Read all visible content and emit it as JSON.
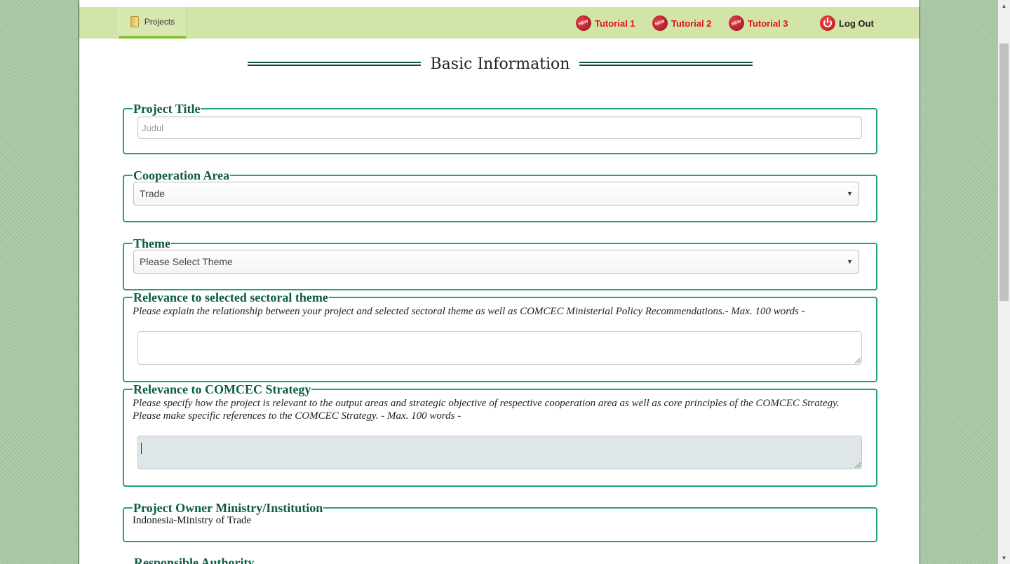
{
  "nav": {
    "projects_label": "Projects",
    "tutorials": [
      "Tutorial 1",
      "Tutorial 2",
      "Tutorial 3"
    ],
    "logout_label": "Log Out",
    "new_badge": "NEW"
  },
  "heading": "Basic Information",
  "sections": {
    "project_title": {
      "legend": "Project Title",
      "placeholder": "Judul"
    },
    "cooperation_area": {
      "legend": "Cooperation Area",
      "selected": "Trade"
    },
    "theme": {
      "legend": "Theme",
      "selected": "Please Select Theme"
    },
    "relevance_theme": {
      "legend": "Relevance to selected sectoral theme",
      "hint": "Please explain the relationship between your project and selected sectoral theme as well as COMCEC Ministerial Policy Recommendations.- Max. 100 words -"
    },
    "relevance_strategy": {
      "legend": "Relevance to COMCEC Strategy",
      "hint": "Please specify how the project is relevant to the output areas and strategic objective of respective cooperation area as well as core principles of the COMCEC Strategy. Please make specific references to the COMCEC Strategy. - Max. 100 words -"
    },
    "owner": {
      "legend": "Project Owner Ministry/Institution",
      "value": "Indonesia-Ministry of Trade"
    },
    "responsible_authority": {
      "legend": "Responsible Authority"
    }
  },
  "colors": {
    "accent": "#1fa37d",
    "legend": "#0d5c46",
    "navbar": "#d3e4a9",
    "tutorial": "#e01414"
  }
}
